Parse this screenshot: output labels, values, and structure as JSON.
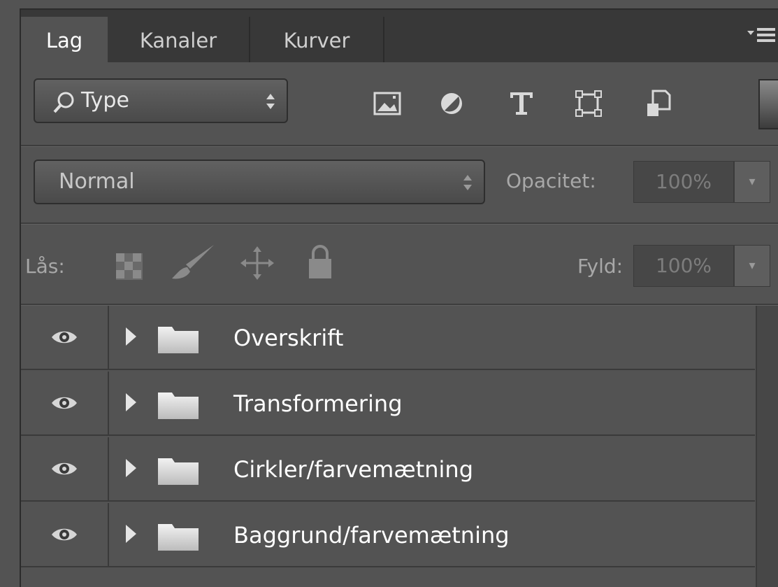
{
  "tabs": [
    {
      "label": "Lag",
      "active": true
    },
    {
      "label": "Kanaler",
      "active": false
    },
    {
      "label": "Kurver",
      "active": false
    }
  ],
  "filter": {
    "kind_label": "Type",
    "icons": [
      "image-filter-icon",
      "adjustment-filter-icon",
      "type-filter-icon",
      "shape-filter-icon",
      "smart-object-filter-icon"
    ]
  },
  "blend": {
    "mode": "Normal",
    "opacity_label": "Opacitet:",
    "opacity_value": "100%"
  },
  "lock": {
    "label": "Lås:",
    "fill_label": "Fyld:",
    "fill_value": "100%"
  },
  "layers": [
    {
      "name": "Overskrift",
      "visible": true,
      "type": "group"
    },
    {
      "name": "Transformering",
      "visible": true,
      "type": "group"
    },
    {
      "name": "Cirkler/farvemætning",
      "visible": true,
      "type": "group"
    },
    {
      "name": "Baggrund/farvemætning",
      "visible": true,
      "type": "group"
    }
  ],
  "colors": {
    "panel_bg": "#535353",
    "tabbar_bg": "#383838",
    "text_active": "#ffffff",
    "text_dim": "#a8a8a8"
  }
}
